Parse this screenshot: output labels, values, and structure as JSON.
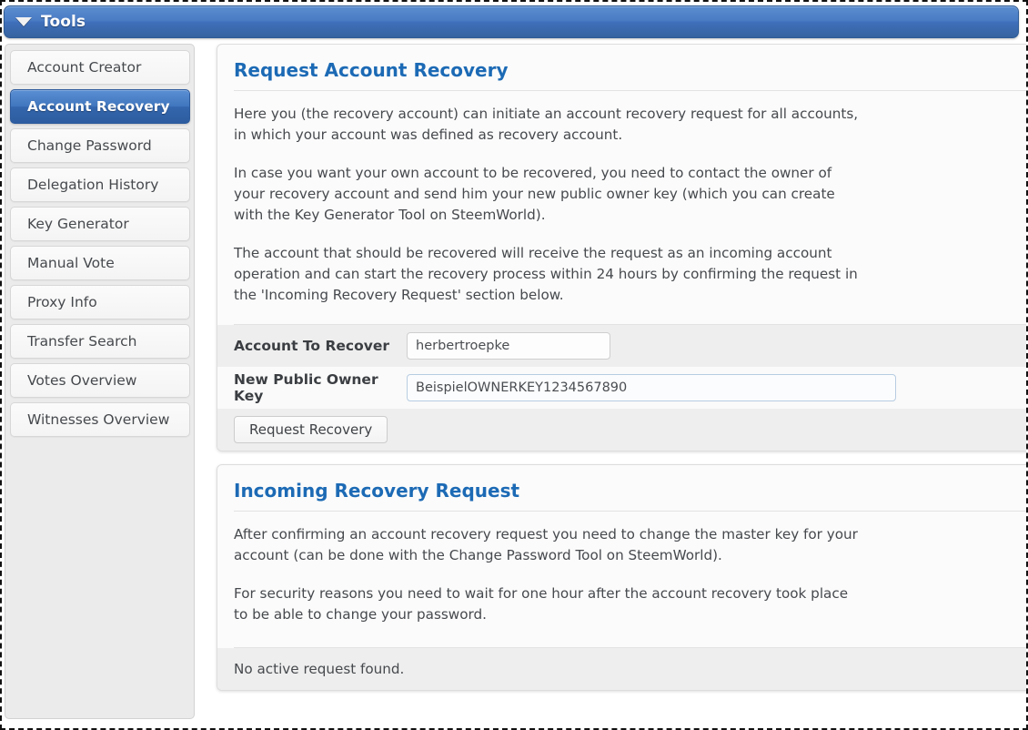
{
  "header": {
    "title": "Tools",
    "caret_icon": "caret-down-icon"
  },
  "sidebar": {
    "items": [
      {
        "label": "Account Creator",
        "active": false
      },
      {
        "label": "Account Recovery",
        "active": true
      },
      {
        "label": "Change Password",
        "active": false
      },
      {
        "label": "Delegation History",
        "active": false
      },
      {
        "label": "Key Generator",
        "active": false
      },
      {
        "label": "Manual Vote",
        "active": false
      },
      {
        "label": "Proxy Info",
        "active": false
      },
      {
        "label": "Transfer Search",
        "active": false
      },
      {
        "label": "Votes Overview",
        "active": false
      },
      {
        "label": "Witnesses Overview",
        "active": false
      }
    ]
  },
  "request_panel": {
    "title": "Request Account Recovery",
    "paragraphs": [
      "Here you (the recovery account) can initiate an account recovery request for all accounts, in which your account was defined as recovery account.",
      "In case you want your own account to be recovered, you need to contact the owner of your recovery account and send him your new public owner key (which you can create with the Key Generator Tool on SteemWorld).",
      "The account that should be recovered will receive the request as an incoming account operation and can start the recovery process within 24 hours by confirming the request in the 'Incoming Recovery Request' section below."
    ],
    "fields": {
      "account_to_recover": {
        "label": "Account To Recover",
        "value": "herbertroepke"
      },
      "new_public_owner_key": {
        "label": "New Public Owner Key",
        "value": "BeispielOWNERKEY1234567890"
      }
    },
    "submit_label": "Request Recovery"
  },
  "incoming_panel": {
    "title": "Incoming Recovery Request",
    "paragraphs": [
      "After confirming an account recovery request you need to change the master key for your account (can be done with the Change Password Tool on SteemWorld).",
      "For security reasons you need to wait for one hour after the account recovery took place to be able to change your password."
    ],
    "status": "No active request found."
  },
  "colors": {
    "accent_blue": "#1c6ab5",
    "header_blue": "#4076bd",
    "active_item_blue": "#3366ad",
    "text": "#46494d",
    "shade_row": "#eeeeee"
  }
}
